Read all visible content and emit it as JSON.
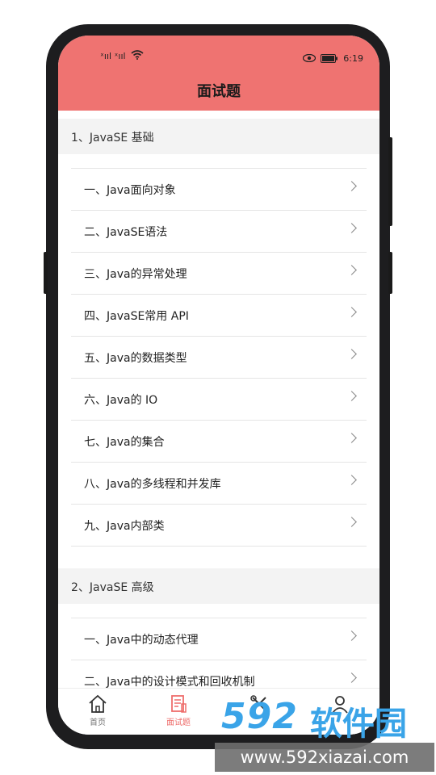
{
  "status": {
    "time": "6:19",
    "signal": "ˣııl ˣııl"
  },
  "header": {
    "title": "面试题"
  },
  "sections": [
    {
      "title": "1、JavaSE 基础",
      "items": [
        {
          "label": "一、Java面向对象"
        },
        {
          "label": "二、JavaSE语法"
        },
        {
          "label": "三、Java的异常处理"
        },
        {
          "label": "四、JavaSE常用 API"
        },
        {
          "label": "五、Java的数据类型"
        },
        {
          "label": "六、Java的 IO"
        },
        {
          "label": "七、Java的集合"
        },
        {
          "label": "八、Java的多线程和并发库"
        },
        {
          "label": "九、Java内部类"
        }
      ]
    },
    {
      "title": "2、JavaSE 高级",
      "items": [
        {
          "label": "一、Java中的动态代理"
        },
        {
          "label": "二、Java中的设计模式和回收机制"
        }
      ]
    }
  ],
  "tabs": [
    {
      "label": "首页",
      "icon": "home-icon",
      "active": false
    },
    {
      "label": "面试题",
      "icon": "document-icon",
      "active": true
    },
    {
      "label": "",
      "icon": "tools-icon",
      "active": false
    },
    {
      "label": "",
      "icon": "user-icon",
      "active": false
    }
  ],
  "watermark": {
    "brand": "592",
    "brand_cn": "软件园",
    "url": "www.592xiazai.com"
  },
  "colors": {
    "header": "#ef7371",
    "accent": "#ee6d6b"
  }
}
